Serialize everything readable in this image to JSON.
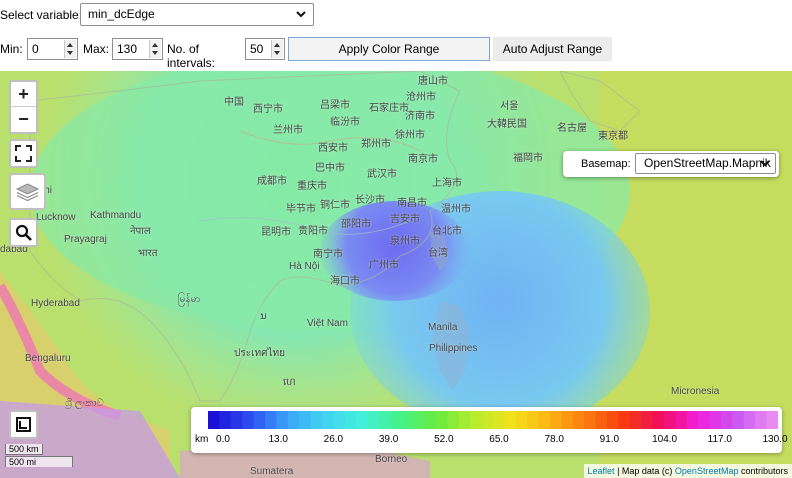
{
  "controls": {
    "select_label": "Select variable:",
    "select_value": "min_dcEdge",
    "min_label": "Min:",
    "min_value": "0",
    "max_label": "Max:",
    "max_value": "130",
    "intervals_label": "No. of intervals:",
    "intervals_value": "50",
    "apply_label": "Apply Color Range",
    "auto_label": "Auto Adjust Range"
  },
  "map": {
    "basemap_label": "Basemap:",
    "basemap_value": "OpenStreetMap.Mapnik",
    "zoom_in": "+",
    "zoom_out": "−",
    "places": [
      {
        "t": "唐山市"
      },
      {
        "t": "沧州市"
      },
      {
        "t": "济南市"
      },
      {
        "t": "徐州市"
      },
      {
        "t": "南京市"
      },
      {
        "t": "上海市"
      },
      {
        "t": "南昌市"
      },
      {
        "t": "温州市"
      },
      {
        "t": "吉安市"
      },
      {
        "t": "泉州市"
      },
      {
        "t": "台北市"
      },
      {
        "t": "台湾"
      },
      {
        "t": "广州市"
      },
      {
        "t": "南宁市"
      },
      {
        "t": "Hà Nội"
      },
      {
        "t": "海口市"
      },
      {
        "t": "Việt Nam"
      },
      {
        "t": "Manila"
      },
      {
        "t": "Philippines"
      },
      {
        "t": "Micronesia"
      },
      {
        "t": "Borneo"
      },
      {
        "t": "中国"
      },
      {
        "t": "西宁市"
      },
      {
        "t": "兰州市"
      },
      {
        "t": "吕梁市"
      },
      {
        "t": "临汾市"
      },
      {
        "t": "石家庄市"
      },
      {
        "t": "郑州市"
      },
      {
        "t": "西安市"
      },
      {
        "t": "巴中市"
      },
      {
        "t": "武汉市"
      },
      {
        "t": "成都市"
      },
      {
        "t": "重庆市"
      },
      {
        "t": "长沙市"
      },
      {
        "t": "毕节市"
      },
      {
        "t": "铜仁市"
      },
      {
        "t": "邵阳市"
      },
      {
        "t": "昆明市"
      },
      {
        "t": "贵阳市"
      },
      {
        "t": "Kathmandu"
      },
      {
        "t": "Lucknow"
      },
      {
        "t": "Prayagraj"
      },
      {
        "t": "Hyderabad"
      },
      {
        "t": "Bengaluru"
      },
      {
        "t": "dabad"
      },
      {
        "t": "ihi"
      },
      {
        "t": "大韓民国"
      },
      {
        "t": "名古屋"
      },
      {
        "t": "東京都"
      },
      {
        "t": "福岡市"
      },
      {
        "t": "서울"
      },
      {
        "t": "Sumatera"
      },
      {
        "t": "ประเทศไทย"
      },
      {
        "t": "ශ්‍රී ලංකාව"
      },
      {
        "t": "ນ"
      },
      {
        "t": "ហេ"
      },
      {
        "t": "မြန်မာ"
      },
      {
        "t": "नेपाल"
      },
      {
        "t": "भारत"
      }
    ],
    "legend": {
      "unit": "km",
      "ticks": [
        "0.0",
        "13.0",
        "26.0",
        "39.0",
        "52.0",
        "65.0",
        "78.0",
        "91.0",
        "104.0",
        "117.0",
        "130.0"
      ],
      "colors": [
        "#1a10d8",
        "#2f4ff0",
        "#3aa6f7",
        "#43d3f2",
        "#43f0d9",
        "#44f28a",
        "#69ec3e",
        "#b6ec2e",
        "#f4e21c",
        "#fbb514",
        "#fb7a10",
        "#f63c10",
        "#f20e5e",
        "#f21edc",
        "#c954f2",
        "#e88cf4"
      ]
    },
    "scale": {
      "km": "500 km",
      "mi": "500 mi"
    },
    "attribution": {
      "leaflet": "Leaflet",
      "mid": " | Map data (c) ",
      "osm": "OpenStreetMap",
      "tail": " contributors"
    }
  }
}
